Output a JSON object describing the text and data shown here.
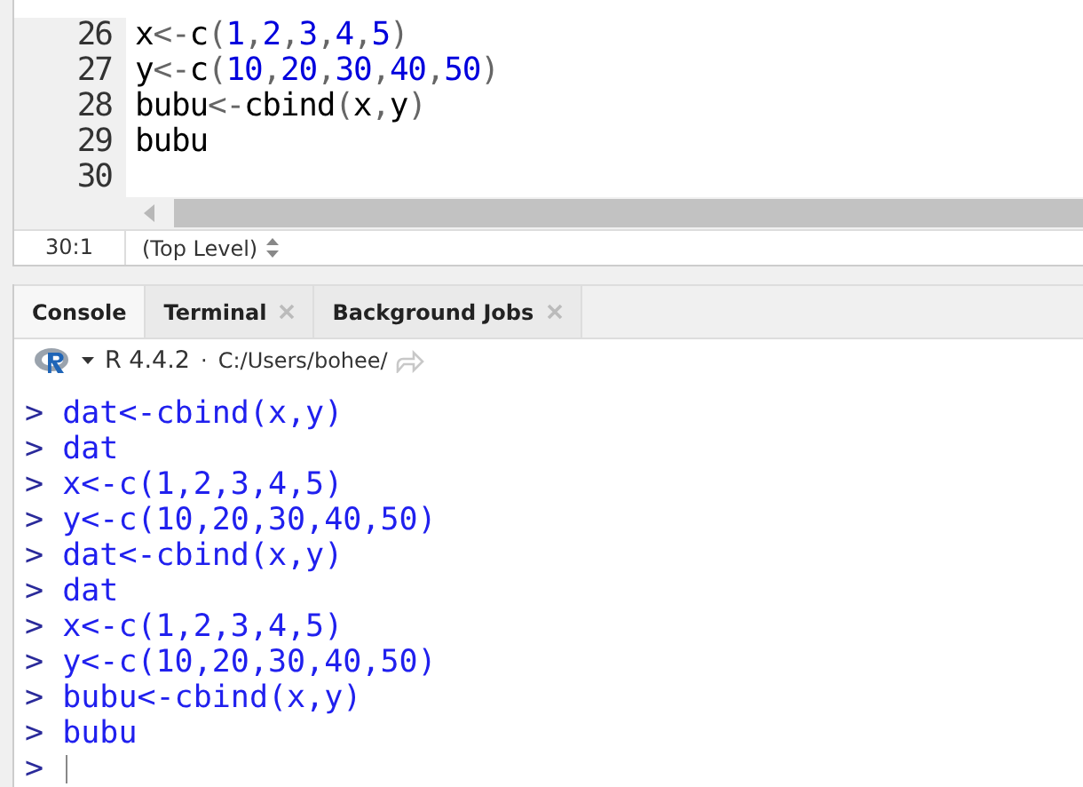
{
  "editor": {
    "lines": [
      {
        "number": "26",
        "code": "x<-c(1,2,3,4,5)"
      },
      {
        "number": "27",
        "code": "y<-c(10,20,30,40,50)"
      },
      {
        "number": "28",
        "code": "bubu<-cbind(x,y)"
      },
      {
        "number": "29",
        "code": "bubu"
      },
      {
        "number": "30"
      }
    ]
  },
  "status_bar": {
    "position": "30:1",
    "scope": "(Top Level)"
  },
  "tabs": [
    {
      "label": "Console",
      "selected": true,
      "closable": false
    },
    {
      "label": "Terminal",
      "selected": false,
      "closable": true
    },
    {
      "label": "Background Jobs",
      "selected": false,
      "closable": true
    }
  ],
  "console_toolbar": {
    "version": "R 4.4.2",
    "separator": "·",
    "path": "C:/Users/bohee/"
  },
  "console": {
    "lines": [
      {
        "prompt": ">",
        "input": "dat<-cbind(x,y)"
      },
      {
        "prompt": ">",
        "input": "dat"
      },
      {
        "prompt": ">",
        "input": "x<-c(1,2,3,4,5)"
      },
      {
        "prompt": ">",
        "input": "y<-c(10,20,30,40,50)"
      },
      {
        "prompt": ">",
        "input": "dat<-cbind(x,y)"
      },
      {
        "prompt": ">",
        "input": "dat"
      },
      {
        "prompt": ">",
        "input": "x<-c(1,2,3,4,5)"
      },
      {
        "prompt": ">",
        "input": "y<-c(10,20,30,40,50)"
      },
      {
        "prompt": ">",
        "input": "bubu<-cbind(x,y)"
      },
      {
        "prompt": ">",
        "input": "bubu"
      }
    ],
    "current_prompt": ">"
  }
}
